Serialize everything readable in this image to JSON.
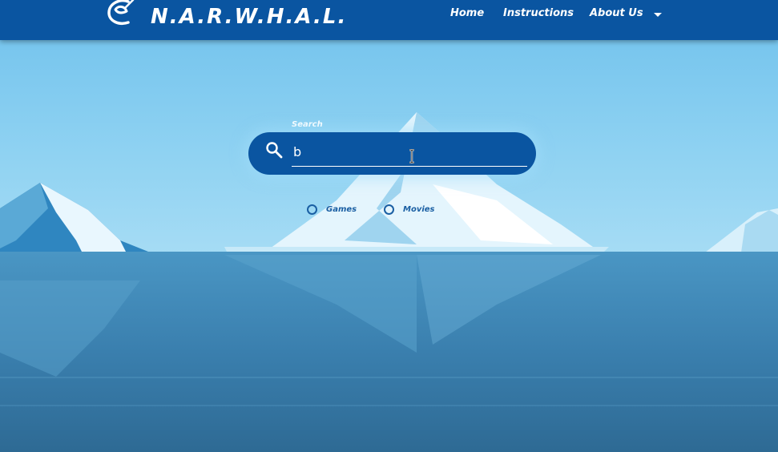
{
  "navbar": {
    "brand": "N.A.R.W.H.A.L.",
    "logo_icon": "narwhal-logo-icon",
    "links": [
      {
        "label": "Home"
      },
      {
        "label": "Instructions"
      },
      {
        "label": "About Us"
      }
    ],
    "dropdown_icon": "caret-down-icon"
  },
  "search": {
    "label": "Search",
    "value": "b",
    "icon": "search-icon"
  },
  "filters": [
    {
      "label": "Games",
      "selected": false
    },
    {
      "label": "Movies",
      "selected": false
    }
  ],
  "colors": {
    "navbar": "#0a55a1",
    "search_box": "#0a55a1",
    "sky_top": "#7ec8ee",
    "sea": "#3a86b2",
    "radio_text": "#1a5fa3"
  }
}
